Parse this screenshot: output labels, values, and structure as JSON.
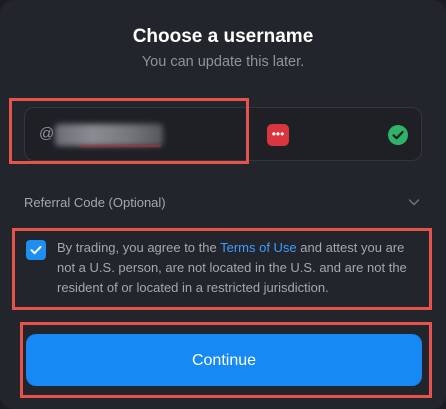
{
  "dialog": {
    "title": "Choose a username",
    "subtitle": "You can update this later."
  },
  "username": {
    "prefix": "@",
    "value_redacted": true,
    "password_manager_icon": "password-manager-icon",
    "valid_icon": "check-circle-icon",
    "valid_color": "#2fb36a"
  },
  "referral": {
    "label": "Referral Code (Optional)",
    "icon": "chevron-down-icon",
    "expanded": false
  },
  "terms": {
    "checked": true,
    "text_before": "By trading, you agree to the ",
    "link_text": "Terms of Use",
    "text_after": " and attest you are not a U.S. person, are not located in the U.S. and are not the resident of or located in a restricted jurisdiction."
  },
  "actions": {
    "continue_label": "Continue"
  },
  "colors": {
    "accent": "#1689f5",
    "link": "#3f9bff",
    "highlight": "#e5534b",
    "background": "#23252c"
  }
}
